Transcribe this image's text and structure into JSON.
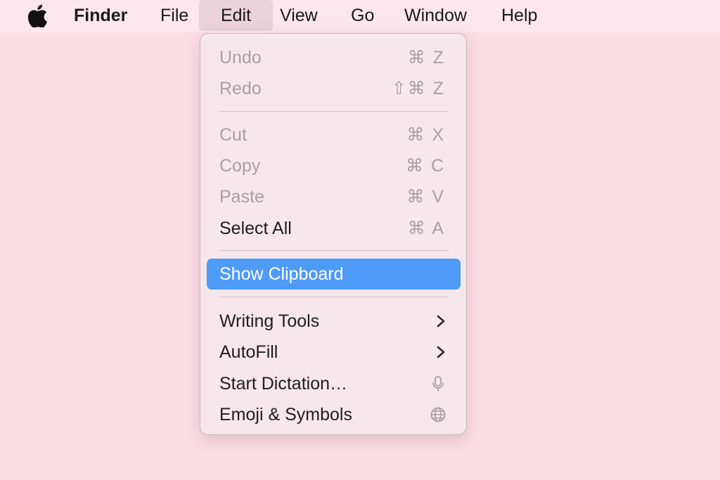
{
  "menubar": {
    "apple_icon": "apple-logo-icon",
    "app_name": "Finder",
    "items": [
      "File",
      "Edit",
      "View",
      "Go",
      "Window",
      "Help"
    ],
    "active_item": "Edit"
  },
  "edit_menu": {
    "undo": {
      "label": "Undo",
      "shortcut": "⌘ Z"
    },
    "redo": {
      "label": "Redo",
      "shortcut": "⇧⌘ Z"
    },
    "cut": {
      "label": "Cut",
      "shortcut": "⌘ X"
    },
    "copy": {
      "label": "Copy",
      "shortcut": "⌘ C"
    },
    "paste": {
      "label": "Paste",
      "shortcut": "⌘ V"
    },
    "select_all": {
      "label": "Select All",
      "shortcut": "⌘ A"
    },
    "show_clipboard": {
      "label": "Show Clipboard"
    },
    "writing_tools": {
      "label": "Writing Tools",
      "icon": "chevron-right-icon"
    },
    "autofill": {
      "label": "AutoFill",
      "icon": "chevron-right-icon"
    },
    "start_dictation": {
      "label": "Start Dictation…",
      "icon": "microphone-icon"
    },
    "emoji_symbols": {
      "label": "Emoji & Symbols",
      "icon": "globe-icon"
    }
  },
  "colors": {
    "desktop": "#fbdde6",
    "menubar": "#fde6ee",
    "menu_background": "#f5e7ec",
    "highlight": "#4f9bf8",
    "disabled_text": "#a8a0a4"
  }
}
